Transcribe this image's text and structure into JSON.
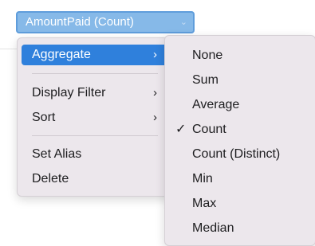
{
  "field_pill": {
    "label": "AmountPaid (Count)",
    "chevron_icon": "⌄"
  },
  "menu": {
    "aggregate_label": "Aggregate",
    "display_filter_label": "Display Filter",
    "sort_label": "Sort",
    "set_alias_label": "Set Alias",
    "delete_label": "Delete",
    "submenu_arrow": "›"
  },
  "submenu": {
    "items": [
      "None",
      "Sum",
      "Average",
      "Count",
      "Count (Distinct)",
      "Min",
      "Max",
      "Median"
    ],
    "selected_index": 3,
    "checkmark": "✓"
  },
  "colors": {
    "pill_background": "#86b9e8",
    "highlight": "#2f80dc",
    "menu_background": "#ece7ec"
  }
}
